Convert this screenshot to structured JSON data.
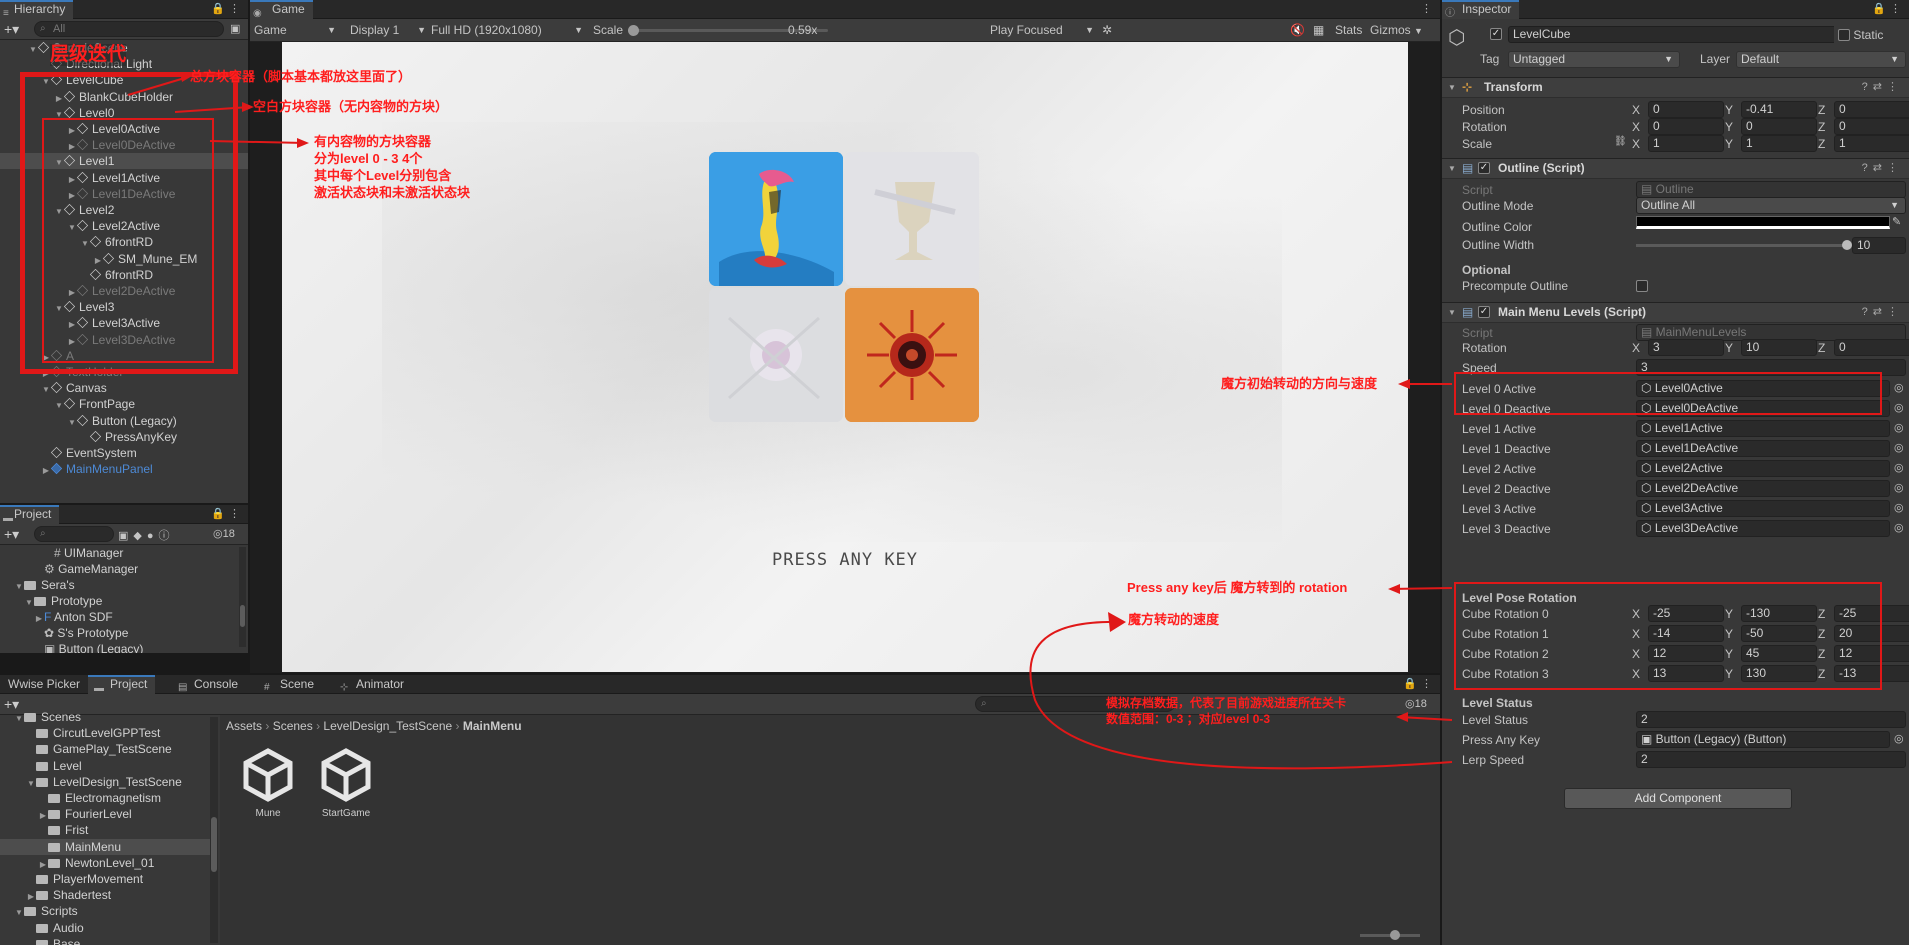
{
  "hierarchy": {
    "tab": "Hierarchy",
    "search_placeholder": "All",
    "items": [
      {
        "label": "SampleScene",
        "indent": 0,
        "dim": false
      },
      {
        "label": "Directional Light",
        "indent": 1
      },
      {
        "label": "LevelCube",
        "indent": 1
      },
      {
        "label": "BlankCubeHolder",
        "indent": 2
      },
      {
        "label": "Level0",
        "indent": 2
      },
      {
        "label": "Level0Active",
        "indent": 3
      },
      {
        "label": "Level0DeActive",
        "indent": 3
      },
      {
        "label": "Level1",
        "indent": 2
      },
      {
        "label": "Level1Active",
        "indent": 3
      },
      {
        "label": "Level1DeActive",
        "indent": 3
      },
      {
        "label": "Level2",
        "indent": 2
      },
      {
        "label": "Level2Active",
        "indent": 3
      },
      {
        "label": "6frontRD",
        "indent": 4
      },
      {
        "label": "SM_Mune_EM",
        "indent": 5
      },
      {
        "label": "6frontRD",
        "indent": 4
      },
      {
        "label": "Level2DeActive",
        "indent": 3
      },
      {
        "label": "Level3",
        "indent": 2
      },
      {
        "label": "Level3Active",
        "indent": 3
      },
      {
        "label": "Level3DeActive",
        "indent": 3
      },
      {
        "label": "A",
        "indent": 1
      },
      {
        "label": "TextHolder",
        "indent": 1
      },
      {
        "label": "Canvas",
        "indent": 1
      },
      {
        "label": "FrontPage",
        "indent": 2
      },
      {
        "label": "Button (Legacy)",
        "indent": 3
      },
      {
        "label": "PressAnyKey",
        "indent": 4
      },
      {
        "label": "EventSystem",
        "indent": 1
      },
      {
        "label": "MainMenuPanel",
        "indent": 1
      }
    ]
  },
  "project_top": {
    "tab": "Project",
    "count": "18",
    "items": [
      {
        "label": "UIManager"
      },
      {
        "label": "GameManager"
      },
      {
        "label": "Sera's"
      },
      {
        "label": "Prototype"
      },
      {
        "label": "Anton SDF"
      },
      {
        "label": "S's Prototype"
      },
      {
        "label": "Button (Legacy)"
      }
    ]
  },
  "game": {
    "tab": "Game",
    "mode": "Game",
    "display": "Display 1",
    "resolution": "Full HD (1920x1080)",
    "scale_label": "Scale",
    "scale_value": "0.59x",
    "play_focused": "Play Focused",
    "stats": "Stats",
    "gizmos": "Gizmos",
    "press_any_key": "PRESS ANY KEY"
  },
  "bottom": {
    "tabs": [
      "Wwise Picker",
      "Project",
      "Console",
      "Scene",
      "Animator"
    ],
    "count": "18",
    "breadcrumb": [
      "Assets",
      "Scenes",
      "LevelDesign_TestScene",
      "MainMenu"
    ],
    "tree": [
      {
        "label": "Scenes"
      },
      {
        "label": "CircutLevelGPPTest"
      },
      {
        "label": "GamePlay_TestScene"
      },
      {
        "label": "Level"
      },
      {
        "label": "LevelDesign_TestScene"
      },
      {
        "label": "Electromagnetism"
      },
      {
        "label": "FourierLevel"
      },
      {
        "label": "Frist"
      },
      {
        "label": "MainMenu"
      },
      {
        "label": "NewtonLevel_01"
      },
      {
        "label": "PlayerMovement"
      },
      {
        "label": "Shadertest"
      },
      {
        "label": "Scripts"
      },
      {
        "label": "Audio"
      },
      {
        "label": "Base"
      }
    ],
    "assets": [
      "Mune",
      "StartGame"
    ]
  },
  "inspector": {
    "tab": "Inspector",
    "object_name": "LevelCube",
    "static_label": "Static",
    "tag_label": "Tag",
    "tag_value": "Untagged",
    "layer_label": "Layer",
    "layer_value": "Default",
    "transform": {
      "title": "Transform",
      "position": {
        "label": "Position",
        "x": "0",
        "y": "-0.41",
        "z": "0"
      },
      "rotation": {
        "label": "Rotation",
        "x": "0",
        "y": "0",
        "z": "0"
      },
      "scale": {
        "label": "Scale",
        "x": "1",
        "y": "1",
        "z": "1"
      }
    },
    "outline": {
      "title": "Outline (Script)",
      "script_label": "Script",
      "script_value": "Outline",
      "mode_label": "Outline Mode",
      "mode_value": "Outline All",
      "color_label": "Outline Color",
      "width_label": "Outline Width",
      "width_value": "10",
      "optional_label": "Optional",
      "precompute_label": "Precompute Outline"
    },
    "mml": {
      "title": "Main Menu Levels (Script)",
      "script_label": "Script",
      "script_value": "MainMenuLevels",
      "rotation": {
        "label": "Rotation",
        "x": "3",
        "y": "10",
        "z": "0"
      },
      "speed": {
        "label": "Speed",
        "value": "3"
      },
      "refs": [
        {
          "label": "Level 0 Active",
          "value": "Level0Active"
        },
        {
          "label": "Level 0 Deactive",
          "value": "Level0DeActive"
        },
        {
          "label": "Level 1 Active",
          "value": "Level1Active"
        },
        {
          "label": "Level 1 Deactive",
          "value": "Level1DeActive"
        },
        {
          "label": "Level 2 Active",
          "value": "Level2Active"
        },
        {
          "label": "Level 2 Deactive",
          "value": "Level2DeActive"
        },
        {
          "label": "Level 3 Active",
          "value": "Level3Active"
        },
        {
          "label": "Level 3 Deactive",
          "value": "Level3DeActive"
        }
      ],
      "pose_header": "Level Pose Rotation",
      "poses": [
        {
          "label": "Cube Rotation 0",
          "x": "-25",
          "y": "-130",
          "z": "-25"
        },
        {
          "label": "Cube Rotation 1",
          "x": "-14",
          "y": "-50",
          "z": "20"
        },
        {
          "label": "Cube Rotation 2",
          "x": "12",
          "y": "45",
          "z": "12"
        },
        {
          "label": "Cube Rotation 3",
          "x": "13",
          "y": "130",
          "z": "-13"
        }
      ],
      "status_header": "Level Status",
      "status": {
        "label": "Level Status",
        "value": "2"
      },
      "press": {
        "label": "Press Any Key",
        "value": "Button (Legacy) (Button)"
      },
      "lerp": {
        "label": "Lerp Speed",
        "value": "2"
      }
    },
    "add_component": "Add Component"
  },
  "annotations": {
    "a1": "层级迭代",
    "a2": "总方块容器（脚本基本都放这里面了）",
    "a3": "空白方块容器（无内容物的方块）",
    "a4_1": "有内容物的方块容器",
    "a4_2": "分为level 0 - 3  4个",
    "a4_3": "其中每个Level分别包含",
    "a4_4": "激活状态块和未激活状态块",
    "a5": "魔方初始转动的方向与速度",
    "a6": "Press any key后 魔方转到的 rotation",
    "a7": "魔方转动的速度",
    "a8_1": "模拟存档数据，代表了目前游戏进度所在关卡",
    "a8_2": "数值范围：0-3 ；对应level 0-3"
  },
  "colors": {
    "accent": "#3a79bb",
    "annotation": "#e01818",
    "tile_blue": "#2b8fdb",
    "tile_orange": "#e08a3a"
  }
}
